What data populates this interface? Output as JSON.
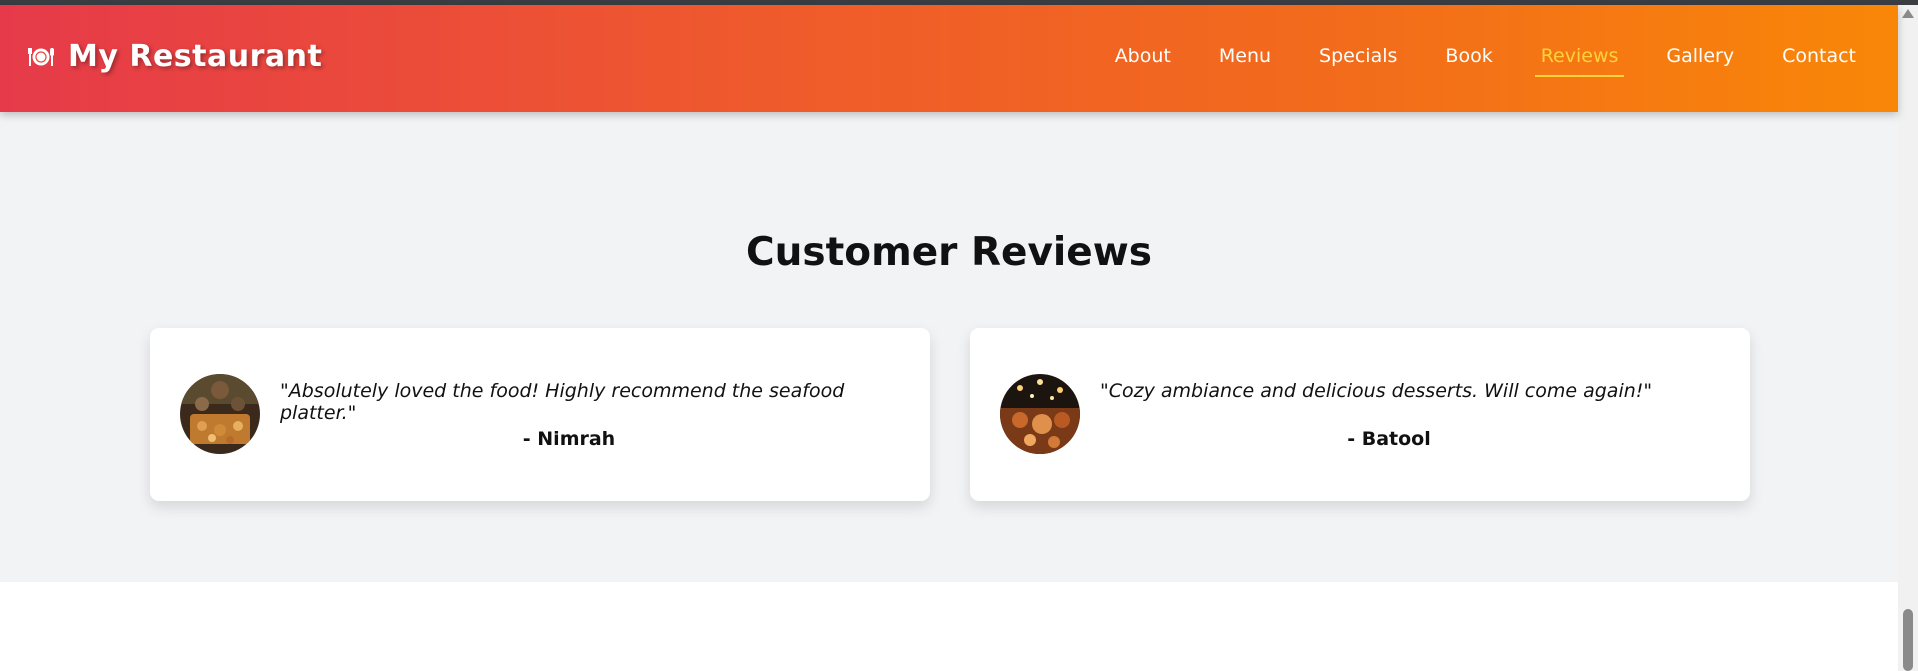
{
  "header": {
    "brand_icon": "plate-with-cutlery-icon",
    "brand_name": "My Restaurant",
    "gradient_colors": [
      "#e63a4a",
      "#f98707"
    ]
  },
  "nav": {
    "items": [
      {
        "label": "About"
      },
      {
        "label": "Menu"
      },
      {
        "label": "Specials"
      },
      {
        "label": "Book"
      },
      {
        "label": "Reviews",
        "active": true
      },
      {
        "label": "Gallery"
      },
      {
        "label": "Contact"
      }
    ],
    "active_color": "#ffd23c"
  },
  "reviews": {
    "title": "Customer Reviews",
    "items": [
      {
        "avatar": "customer-photo-dining-table",
        "quote": "\"Absolutely loved the food! Highly recommend the seafood platter.\"",
        "author": "- Nimrah"
      },
      {
        "avatar": "customer-photo-evening-party",
        "quote": "\"Cozy ambiance and delicious desserts. Will come again!\"",
        "author": "- Batool"
      }
    ]
  }
}
